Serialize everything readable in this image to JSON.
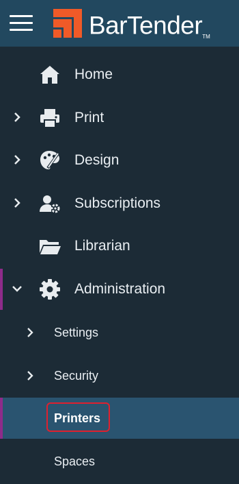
{
  "header": {
    "brand_name": "BarTender",
    "trademark": "TM",
    "brand_color": "#f05a28"
  },
  "nav": {
    "items": [
      {
        "label": "Home",
        "icon": "home-icon",
        "has_chevron": false,
        "expanded": false
      },
      {
        "label": "Print",
        "icon": "printer-icon",
        "has_chevron": true,
        "expanded": false
      },
      {
        "label": "Design",
        "icon": "palette-icon",
        "has_chevron": true,
        "expanded": false
      },
      {
        "label": "Subscriptions",
        "icon": "user-gear-icon",
        "has_chevron": true,
        "expanded": false
      },
      {
        "label": "Librarian",
        "icon": "folder-icon",
        "has_chevron": false,
        "expanded": false
      },
      {
        "label": "Administration",
        "icon": "gear-icon",
        "has_chevron": true,
        "expanded": true
      }
    ],
    "admin_subitems": [
      {
        "label": "Settings",
        "has_chevron": true,
        "selected": false
      },
      {
        "label": "Security",
        "has_chevron": true,
        "selected": false
      },
      {
        "label": "Printers",
        "has_chevron": false,
        "selected": true
      },
      {
        "label": "Spaces",
        "has_chevron": false,
        "selected": false
      }
    ]
  },
  "colors": {
    "header_bg": "#22485f",
    "sidebar_bg": "#1c2b36",
    "selected_bg": "#2a5470",
    "active_marker": "#8e2b8a",
    "highlight_box": "#e0202e"
  }
}
